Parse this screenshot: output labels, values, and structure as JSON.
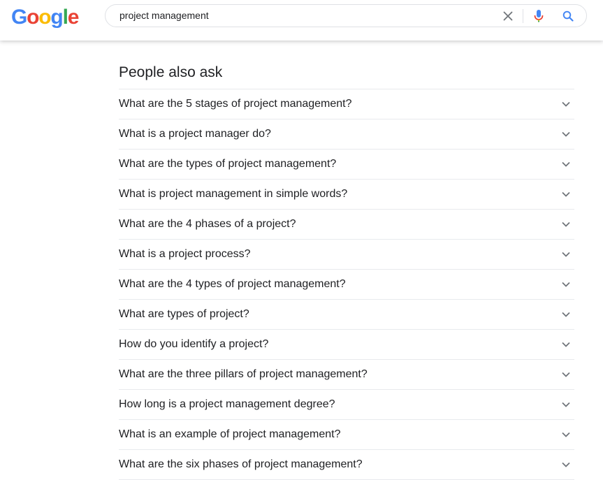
{
  "header": {
    "logo_letters": [
      {
        "ch": "G",
        "color": "#4285F4"
      },
      {
        "ch": "o",
        "color": "#EA4335"
      },
      {
        "ch": "o",
        "color": "#FBBC05"
      },
      {
        "ch": "g",
        "color": "#4285F4"
      },
      {
        "ch": "l",
        "color": "#34A853"
      },
      {
        "ch": "e",
        "color": "#EA4335"
      }
    ],
    "search": {
      "value": "project management"
    },
    "icons": {
      "clear": "close-icon",
      "mic": "microphone-icon",
      "search": "search-icon"
    }
  },
  "people_also_ask": {
    "title": "People also ask",
    "questions": [
      "What are the 5 stages of project management?",
      "What is a project manager do?",
      "What are the types of project management?",
      "What is project management in simple words?",
      "What are the 4 phases of a project?",
      "What is a project process?",
      "What are the 4 types of project management?",
      "What are types of project?",
      "How do you identify a project?",
      "What are the three pillars of project management?",
      "How long is a project management degree?",
      "What is an example of project management?",
      "What are the six phases of project management?"
    ]
  },
  "colors": {
    "accent_blue": "#4285F4",
    "red": "#EA4335",
    "text": "#202124",
    "chevron": "#70757a"
  }
}
